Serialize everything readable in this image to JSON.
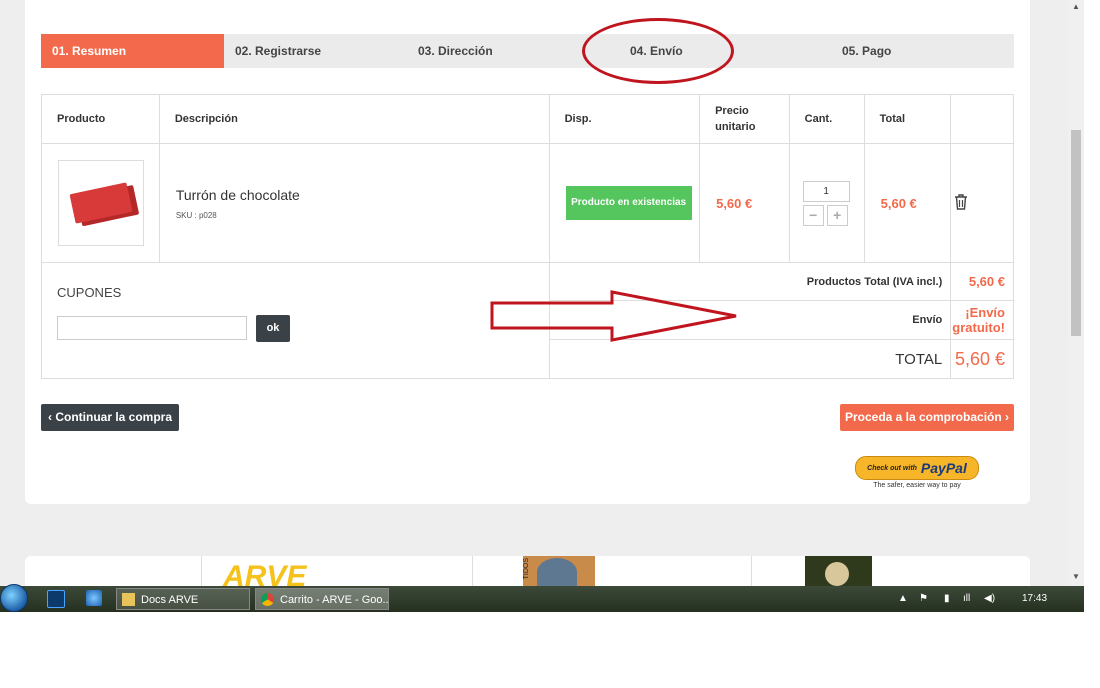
{
  "steps": [
    {
      "label": "01. Resumen"
    },
    {
      "label": "02. Registrarse"
    },
    {
      "label": "03. Dirección"
    },
    {
      "label": "04. Envío"
    },
    {
      "label": "05. Pago"
    }
  ],
  "table": {
    "headers": [
      "Producto",
      "Descripción",
      "Disp.",
      "Precio unitario",
      "Cant.",
      "Total"
    ],
    "product": {
      "name": "Turrón de chocolate",
      "sku": "SKU : p028",
      "availability": "Producto en existencias",
      "unit_price": "5,60 €",
      "quantity": "1",
      "total": "5,60 €"
    },
    "summary": {
      "products_total_label": "Productos Total (IVA incl.)",
      "products_total_value": "5,60 €",
      "shipping_label": "Envío",
      "shipping_value": "¡Envío gratuito!",
      "total_label": "TOTAL",
      "total_value": "5,60 €"
    }
  },
  "coupons": {
    "title": "CUPONES",
    "input_value": "",
    "ok_label": "ok"
  },
  "actions": {
    "continue_label": "Continuar la compra",
    "checkout_label": "Proceda a la comprobación"
  },
  "paypal": {
    "small": "Check out with",
    "brand": "PayPal",
    "tagline": "The safer, easier way to pay"
  },
  "bottom_strip": {
    "logo_text": "ARVE",
    "side_text": "TIDOS"
  },
  "taskbar": {
    "tasks": [
      {
        "label": "Docs ARVE",
        "icon": "folder-icon"
      },
      {
        "label": "Carrito - ARVE - Goo...",
        "icon": "chrome-icon"
      }
    ],
    "pinned": [
      "photoshop-icon",
      "internet-explorer-icon"
    ],
    "clock": "17:43"
  },
  "colors": {
    "accent": "#f26a4b",
    "dark_button": "#3b4247",
    "stock_green": "#55c65e",
    "annotation_red": "#c0151f"
  }
}
